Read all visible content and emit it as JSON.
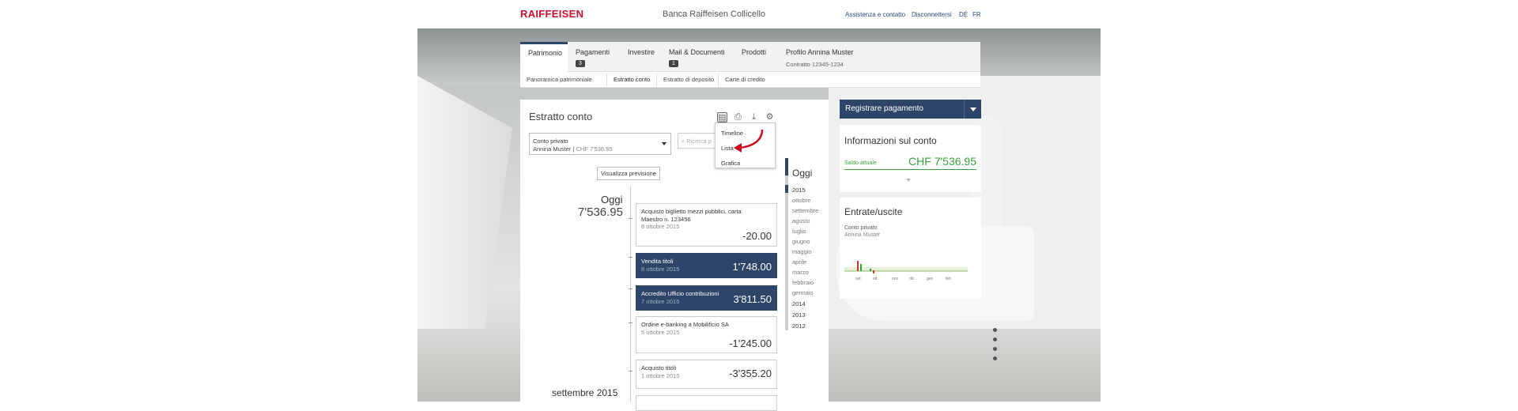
{
  "header": {
    "logo": "RAIFFEISEN",
    "bank_name": "Banca Raiffeisen Collicello",
    "links": [
      "Assistenza e contatto",
      "Disconnettersi"
    ],
    "languages": [
      "DE",
      "FR"
    ]
  },
  "main_tabs": [
    {
      "label": "Patrimonio",
      "active": true
    },
    {
      "label": "Pagamenti",
      "badge": "3"
    },
    {
      "label": "Investire"
    },
    {
      "label": "Mail & Documenti",
      "badge": "1"
    },
    {
      "label": "Prodotti"
    },
    {
      "label": "Profilo Annina Muster",
      "sub": "Contratto 12345-1234"
    }
  ],
  "sub_tabs": [
    "Panoramica patrimoniale",
    "Estratto conto",
    "Estratto di deposito",
    "Carte di credito"
  ],
  "statement": {
    "title": "Estratto conto",
    "account_select": {
      "name": "Conto privato",
      "owner": "Annina Muster",
      "balance": "CHF 7'536.95"
    },
    "search_placeholder": "Ricerca p",
    "view_menu": [
      "Timeline",
      "Lista",
      "Grafica"
    ],
    "forecast_button": "Visualizza previsione",
    "today_label": "Oggi",
    "today_value": "7'536.95",
    "next_month": "settembre 2015",
    "transactions": [
      {
        "title": "Acquisto biglietto mezzi pubblici, carta Maestro n. 123456",
        "date": "8 ottobre 2015",
        "amount": "-20.00",
        "highlight": false
      },
      {
        "title": "Vendita titoli",
        "date": "8 ottobre 2015",
        "amount": "1'748.00",
        "highlight": true
      },
      {
        "title": "Accredito Ufficio contribuzioni",
        "date": "7 ottobre 2015",
        "amount": "3'811.50",
        "highlight": true
      },
      {
        "title": "Ordine e-banking a Mobilificio SA",
        "date": "5 ottobre 2015",
        "amount": "-1'245.00",
        "highlight": false
      },
      {
        "title": "Acquisto titoli",
        "date": "1 ottobre 2015",
        "amount": "-3'355.20",
        "highlight": false
      }
    ]
  },
  "year_nav": {
    "today": "Oggi",
    "items": [
      "2015",
      "ottobre",
      "settembre",
      "agosto",
      "luglio",
      "giugno",
      "maggio",
      "aprile",
      "marzo",
      "febbraio",
      "gennaio",
      "2014",
      "2013",
      "2012"
    ]
  },
  "sidebar": {
    "action_button": "Registrare pagamento",
    "account_info": {
      "title": "Informazioni sul conto",
      "label": "Saldo attuale",
      "value": "CHF 7'536.95"
    },
    "income_expenses": {
      "title": "Entrate/uscite",
      "account": "Conto privato",
      "owner": "Annina Muster",
      "months": [
        "set",
        "ott",
        "nov",
        "dic",
        "gen",
        "feb"
      ]
    }
  },
  "colors": {
    "brand_red": "#c8102e",
    "navy": "#2d4569",
    "positive_green": "#3a9b3a",
    "negative_red": "#c0392b"
  }
}
